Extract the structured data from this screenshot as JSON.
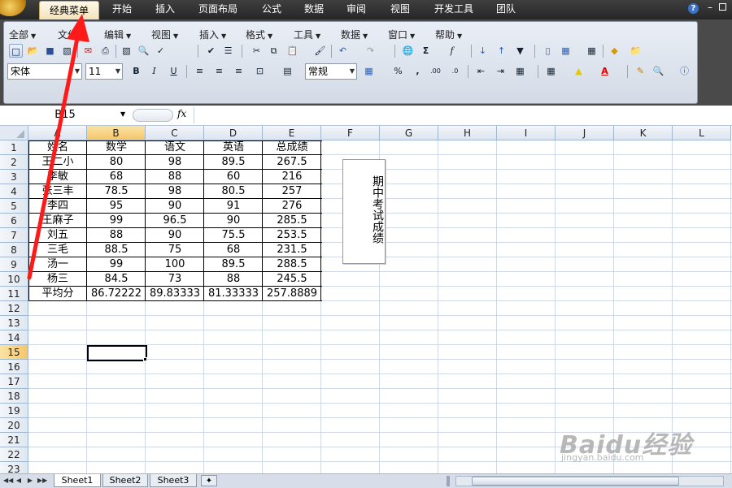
{
  "ribbon_tabs": [
    "经典菜单",
    "开始",
    "插入",
    "页面布局",
    "公式",
    "数据",
    "审阅",
    "视图",
    "开发工具",
    "团队"
  ],
  "classic_menus": [
    "全部",
    "文件",
    "编辑",
    "视图",
    "插入",
    "格式",
    "工具",
    "数据",
    "窗口",
    "帮助"
  ],
  "font_name": "宋体",
  "font_size": "11",
  "number_format": "常规",
  "name_box": "B15",
  "formula_fx": "fx",
  "help_icon": "?",
  "columns": [
    "A",
    "B",
    "C",
    "D",
    "E",
    "F",
    "G",
    "H",
    "I",
    "J",
    "K",
    "L"
  ],
  "rows": [
    "1",
    "2",
    "3",
    "4",
    "5",
    "6",
    "7",
    "8",
    "9",
    "10",
    "11",
    "12",
    "13",
    "14",
    "15",
    "16",
    "17",
    "18",
    "19",
    "20",
    "21",
    "22",
    "23"
  ],
  "selected_cell": {
    "column": "B",
    "row": "15"
  },
  "table": {
    "headers": [
      "姓名",
      "数学",
      "语文",
      "英语",
      "总成绩"
    ],
    "rows": [
      [
        "王二小",
        "80",
        "98",
        "89.5",
        "267.5"
      ],
      [
        "李敏",
        "68",
        "88",
        "60",
        "216"
      ],
      [
        "张三丰",
        "78.5",
        "98",
        "80.5",
        "257"
      ],
      [
        "李四",
        "95",
        "90",
        "91",
        "276"
      ],
      [
        "王麻子",
        "99",
        "96.5",
        "90",
        "285.5"
      ],
      [
        "刘五",
        "88",
        "90",
        "75.5",
        "253.5"
      ],
      [
        "三毛",
        "88.5",
        "75",
        "68",
        "231.5"
      ],
      [
        "汤一",
        "99",
        "100",
        "89.5",
        "288.5"
      ],
      [
        "杨三",
        "84.5",
        "73",
        "88",
        "245.5"
      ]
    ],
    "average": [
      "平均分",
      "86.72222",
      "89.83333",
      "81.33333",
      "257.8889"
    ]
  },
  "textbox": "期中考试成绩",
  "sheet_tabs": [
    "Sheet1",
    "Sheet2",
    "Sheet3"
  ],
  "active_sheet": "Sheet1",
  "watermark": {
    "main": "Baidu经验",
    "sub": "jingyan.baidu.com"
  },
  "colors": {
    "tab_bar": "#2e2e2e",
    "ribbon_panel": "#dfe5ee",
    "selected_header": "#f5c66a",
    "arrow": "#ff1a1a"
  },
  "toolbar_icons": {
    "standard": [
      "new-icon",
      "open-icon",
      "save-icon",
      "permission-icon",
      "email-icon",
      "print-icon",
      "print-preview-icon",
      "research-icon",
      "spelling-icon",
      "cut-icon",
      "copy-icon",
      "paste-icon",
      "format-painter-icon",
      "undo-icon",
      "redo-icon",
      "hyperlink-icon",
      "autosum-icon",
      "insert-function-icon",
      "sort-asc-icon",
      "sort-desc-icon",
      "filter-icon",
      "chart-icon",
      "pivot-icon",
      "table-icon",
      "conditional-icon",
      "folder-icon"
    ],
    "formatting": [
      "bold-icon",
      "italic-icon",
      "underline-icon",
      "align-left-icon",
      "align-center-icon",
      "align-right-icon",
      "merge-center-icon",
      "wrap-icon",
      "currency-icon",
      "percent-icon",
      "comma-icon",
      "increase-decimal-icon",
      "decrease-decimal-icon",
      "decrease-indent-icon",
      "increase-indent-icon",
      "cell-styles-icon",
      "borders-icon",
      "fill-color-icon",
      "font-color-icon",
      "comment-icon",
      "zoom-icon",
      "help-icon"
    ]
  }
}
